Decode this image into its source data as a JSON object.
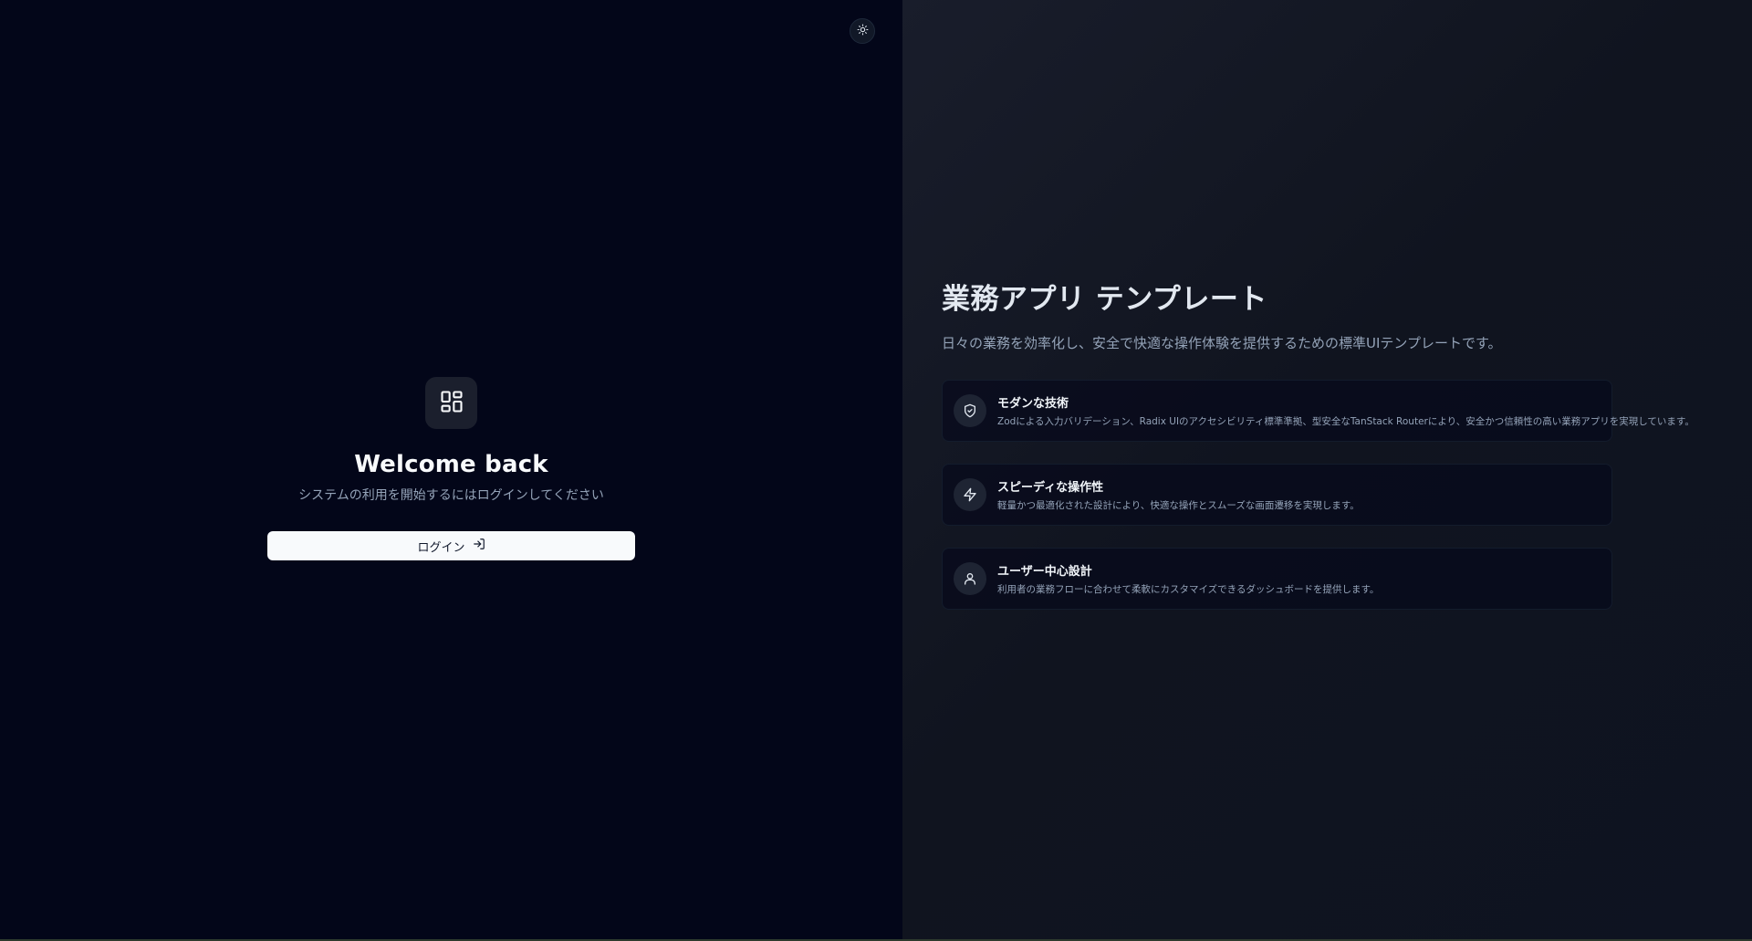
{
  "login": {
    "title": "Welcome back",
    "subtitle": "システムの利用を開始するにはログインしてください",
    "button_label": "ログイン"
  },
  "hero": {
    "title": "業務アプリ テンプレート",
    "description": "日々の業務を効率化し、安全で快適な操作体験を提供するための標準UIテンプレートです。"
  },
  "features": [
    {
      "icon": "shield-check-icon",
      "title": "モダンな技術",
      "description": "Zodによる入力バリデーション、Radix UIのアクセシビリティ標準準拠、型安全なTanStack Routerにより、安全かつ信頼性の高い業務アプリを実現しています。"
    },
    {
      "icon": "lightning-icon",
      "title": "スピーディな操作性",
      "description": "軽量かつ最適化された設計により、快適な操作とスムーズな画面遷移を実現します。"
    },
    {
      "icon": "user-icon",
      "title": "ユーザー中心設計",
      "description": "利用者の業務フローに合わせて柔軟にカスタマイズできるダッシュボードを提供します。"
    }
  ],
  "colors": {
    "left_bg": "#030619",
    "right_bg": "#131826",
    "button_bg": "#f8fafc",
    "text_muted": "#94a3b8"
  }
}
